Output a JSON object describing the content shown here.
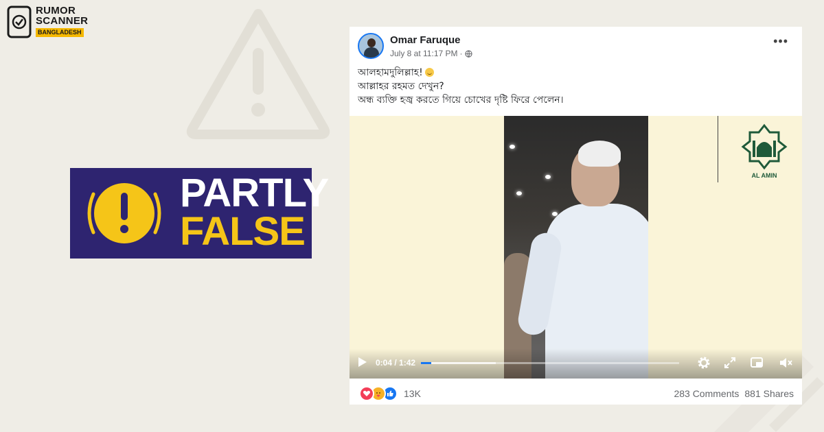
{
  "brand": {
    "line1": "RUMOR",
    "line2": "SCANNER",
    "line3": "BANGLADESH"
  },
  "verdict": {
    "line1": "PARTLY",
    "line2": "FALSE",
    "colors": {
      "badge_bg": "#2e2470",
      "accent": "#f5c518",
      "text": "#ffffff"
    }
  },
  "post": {
    "author": "Omar Faruque",
    "timestamp": "July 8 at 11:17 PM",
    "separator": "·",
    "privacy_icon": "globe-icon",
    "more_icon": "more-options-icon",
    "text_lines": [
      "আলহামদুলিল্লাহ!",
      "আল্লাহর রহমত দেখুন?",
      "অন্ধ ব্যক্তি হজ্ব করতে গিয়ে চোখের দৃষ্টি ফিরে পেলেন।"
    ],
    "video": {
      "time_display": "0:04 / 1:42",
      "current_seconds": 4,
      "duration_seconds": 102,
      "buffered_fraction": 0.29,
      "watermark_text": "AL AMIN",
      "controls": [
        "play-icon",
        "settings-icon",
        "fullscreen-icon",
        "picture-in-picture-icon",
        "volume-icon"
      ]
    },
    "reactions": {
      "types": [
        "love",
        "care",
        "like"
      ],
      "count": "13K"
    },
    "comments": "283 Comments",
    "shares": "881 Shares"
  }
}
